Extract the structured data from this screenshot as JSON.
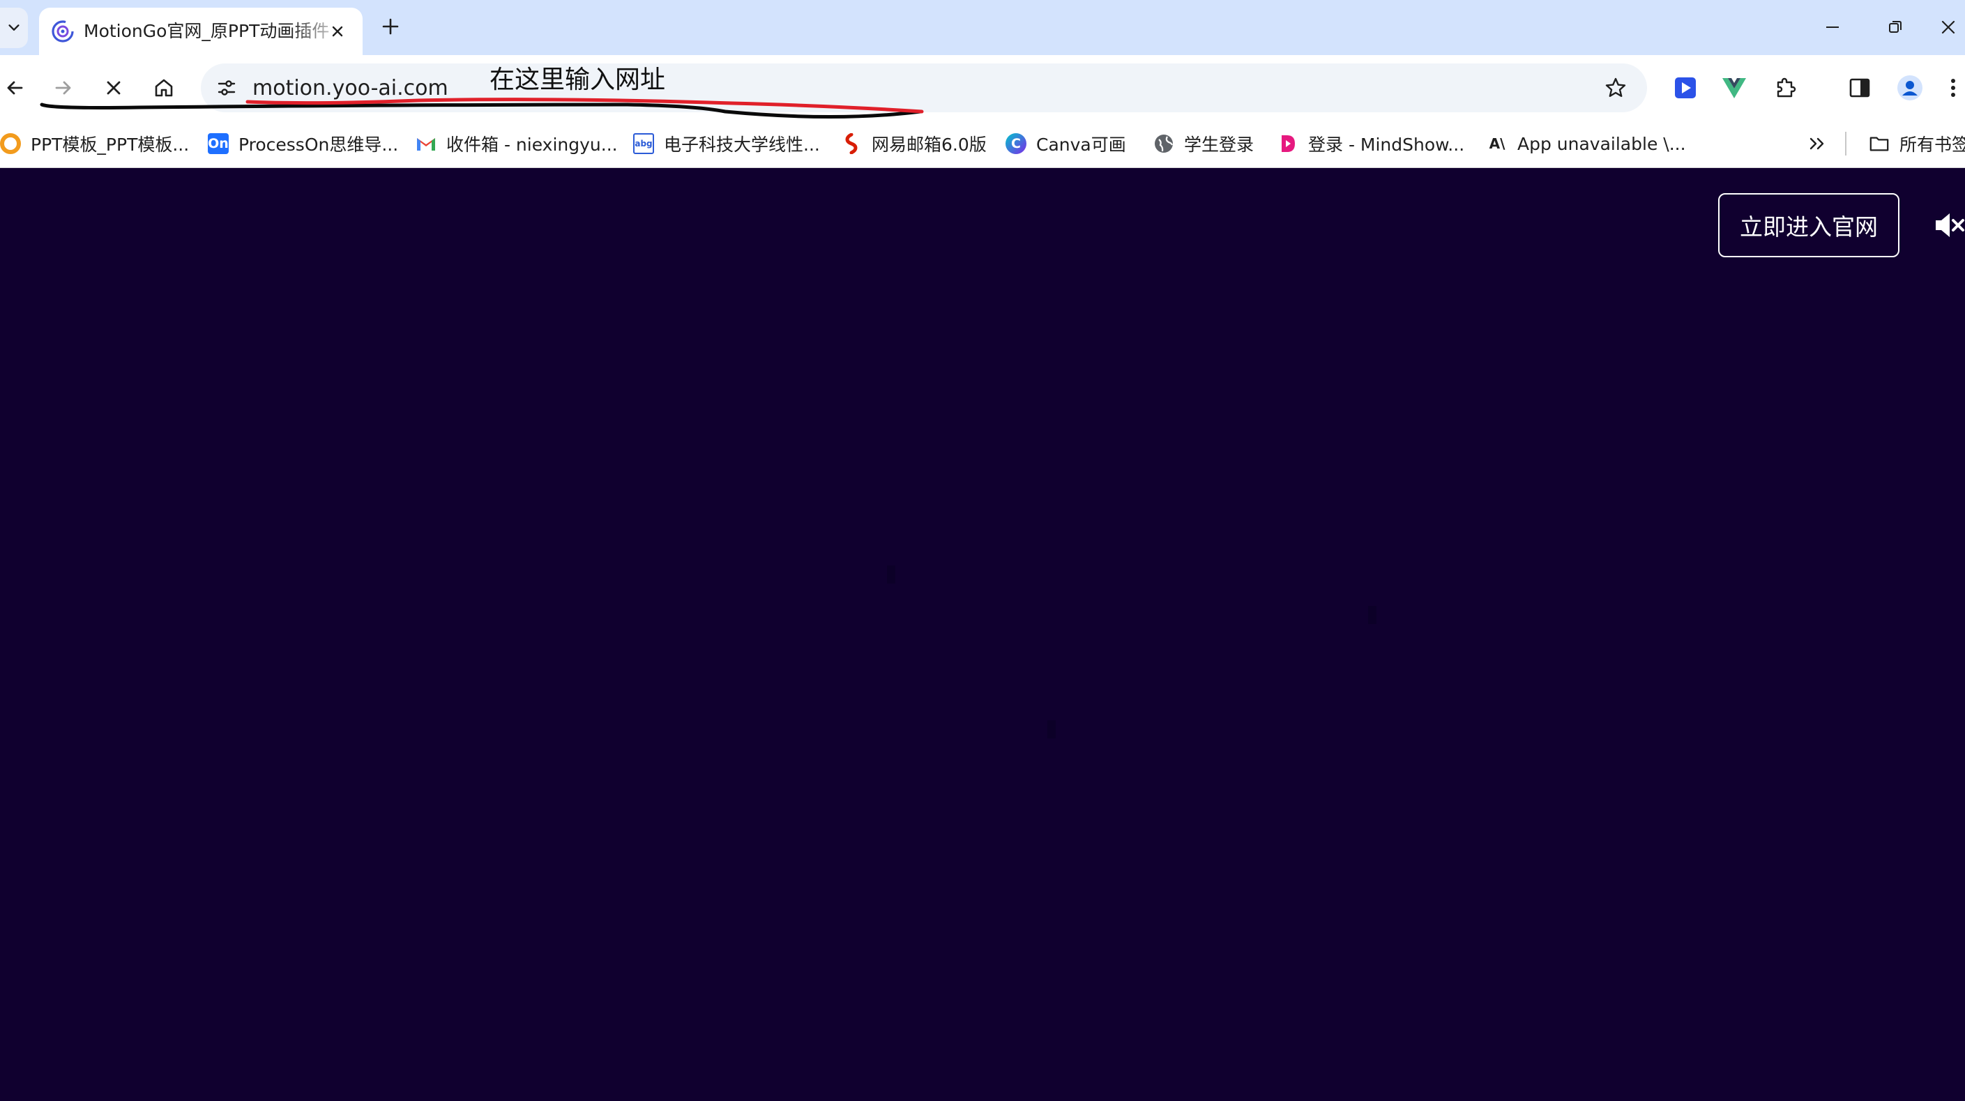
{
  "browser": {
    "tab": {
      "title": "MotionGo官网_原PPT动画插件"
    },
    "address": {
      "url": "motion.yoo-ai.com"
    },
    "bookmarks": [
      {
        "label": "PPT模板_PPT模板...",
        "icon": "ppt-template-icon"
      },
      {
        "label": "ProcessOn思维导...",
        "icon": "processon-icon",
        "icon_text": "On"
      },
      {
        "label": "收件箱 - niexingyu...",
        "icon": "gmail-icon",
        "icon_text": "M"
      },
      {
        "label": "电子科技大学线性...",
        "icon": "uestc-icon",
        "icon_text": "abg"
      },
      {
        "label": "网易邮箱6.0版",
        "icon": "netease-mail-icon"
      },
      {
        "label": "Canva可画",
        "icon": "canva-icon",
        "icon_text": "C"
      },
      {
        "label": "学生登录",
        "icon": "globe-icon"
      },
      {
        "label": "登录 - MindShow...",
        "icon": "mindshow-icon"
      },
      {
        "label": "App unavailable \\...",
        "icon": "anthropic-icon",
        "icon_text": "A\\"
      }
    ],
    "all_bookmarks_label": "所有书签"
  },
  "page": {
    "enter_button_label": "立即进入官网",
    "background_color": "#10002f"
  },
  "annotation": {
    "text": "在这里输入网址"
  },
  "colors": {
    "tab_strip": "#d3e3fd",
    "ink_red": "#e0202a",
    "ink_black": "#0a0a0a"
  }
}
